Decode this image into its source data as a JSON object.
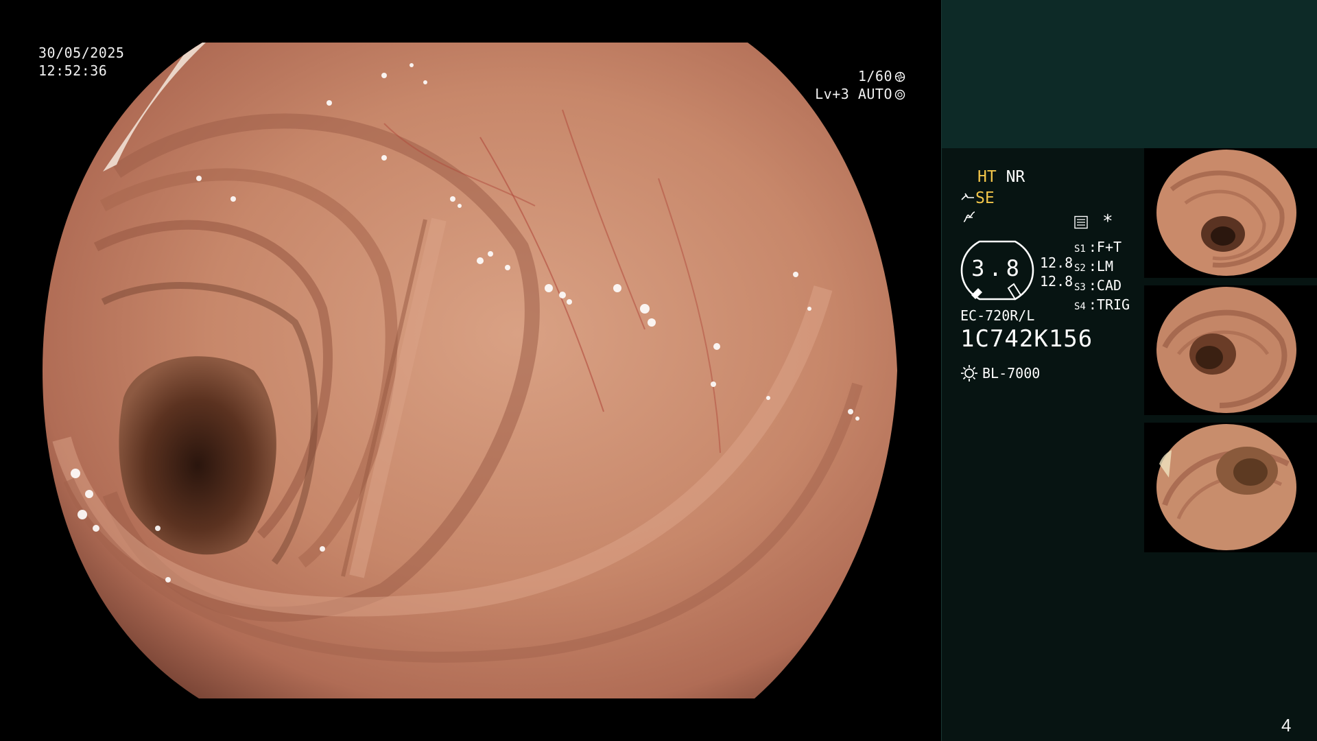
{
  "overlay": {
    "date": "30/05/2025",
    "time": "12:52:36",
    "shutter": "1/60",
    "level": "Lv+3",
    "exposure": "AUTO"
  },
  "panel": {
    "ht": "HT",
    "nr": "NR",
    "se": "SE",
    "gauge_value": "3.8",
    "gauge_side_top": "12.8",
    "gauge_side_bottom": "12.8",
    "asterisk": "*",
    "s_buttons": [
      {
        "label": "S1",
        "value": "F+T"
      },
      {
        "label": "S2",
        "value": "LM"
      },
      {
        "label": "S3",
        "value": "CAD"
      },
      {
        "label": "S4",
        "value": "TRIG"
      }
    ],
    "model": "EC-720R/L",
    "serial": "1C742K156",
    "light_source": "BL-7000"
  },
  "colors": {
    "panel_top": "#0d2a27",
    "panel_body": "#071412",
    "accent_yellow": "#f3c64a",
    "mucosa": "#c98a6a"
  },
  "icons": {
    "shutter": "aperture-icon",
    "auto": "iris-icon",
    "se": "enhance-icon",
    "tilde": "curve-icon",
    "memo": "memo-icon",
    "light": "light-source-icon"
  },
  "page_number": "4"
}
